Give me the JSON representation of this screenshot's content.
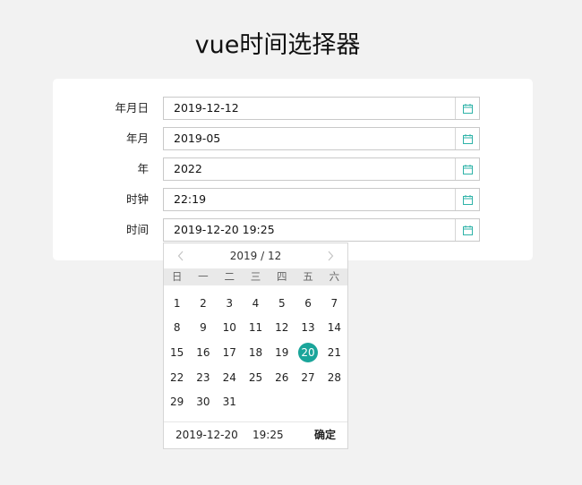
{
  "page": {
    "title": "vue时间选择器"
  },
  "form": {
    "rows": [
      {
        "label": "年月日",
        "value": "2019-12-12"
      },
      {
        "label": "年月",
        "value": "2019-05"
      },
      {
        "label": "年",
        "value": "2022"
      },
      {
        "label": "时钟",
        "value": "22:19"
      },
      {
        "label": "时间",
        "value": "2019-12-20 19:25"
      }
    ]
  },
  "picker": {
    "title": "2019 / 12",
    "weekdays": [
      "日",
      "一",
      "二",
      "三",
      "四",
      "五",
      "六"
    ],
    "days": [
      "1",
      "2",
      "3",
      "4",
      "5",
      "6",
      "7",
      "8",
      "9",
      "10",
      "11",
      "12",
      "13",
      "14",
      "15",
      "16",
      "17",
      "18",
      "19",
      "20",
      "21",
      "22",
      "23",
      "24",
      "25",
      "26",
      "27",
      "28",
      "29",
      "30",
      "31"
    ],
    "selected_day": "20",
    "footer": {
      "date": "2019-12-20",
      "time": "19:25",
      "confirm": "确定"
    }
  },
  "colors": {
    "accent": "#1aa59a",
    "icon": "#2fb3a8"
  }
}
